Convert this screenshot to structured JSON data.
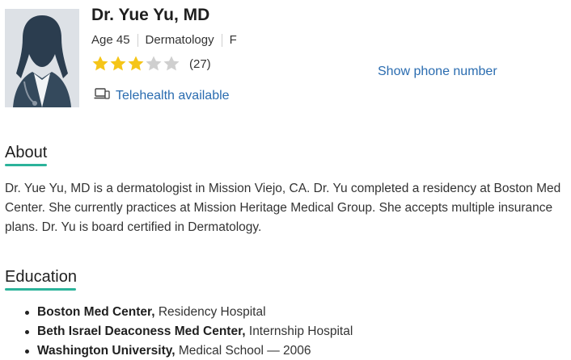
{
  "doctor": {
    "name": "Dr. Yue Yu, MD",
    "age": "Age 45",
    "specialty": "Dermatology",
    "gender": "F",
    "rating": 3,
    "rating_max": 5,
    "review_count": "(27)",
    "telehealth": "Telehealth available",
    "phone_link": "Show phone number"
  },
  "about": {
    "title": "About",
    "text": "Dr. Yue Yu, MD is a dermatologist in Mission Viejo, CA. Dr. Yu completed a residency at Boston Med Center. She currently practices at Mission Heritage Medical Group. She accepts multiple insurance plans. Dr. Yu is board certified in Dermatology."
  },
  "education": {
    "title": "Education",
    "items": [
      {
        "school": "Boston Med Center,",
        "detail": " Residency Hospital"
      },
      {
        "school": "Beth Israel Deaconess Med Center,",
        "detail": " Internship Hospital"
      },
      {
        "school": "Washington University,",
        "detail": " Medical School — 2006"
      }
    ]
  },
  "colors": {
    "accent_underline": "#2bb39a",
    "link": "#2a6cb0",
    "star_filled": "#f5c518",
    "star_empty": "#cfcfcf"
  },
  "icons": {
    "photo": "doctor-silhouette-icon",
    "telehealth": "laptop-phone-icon",
    "star": "star-icon"
  }
}
